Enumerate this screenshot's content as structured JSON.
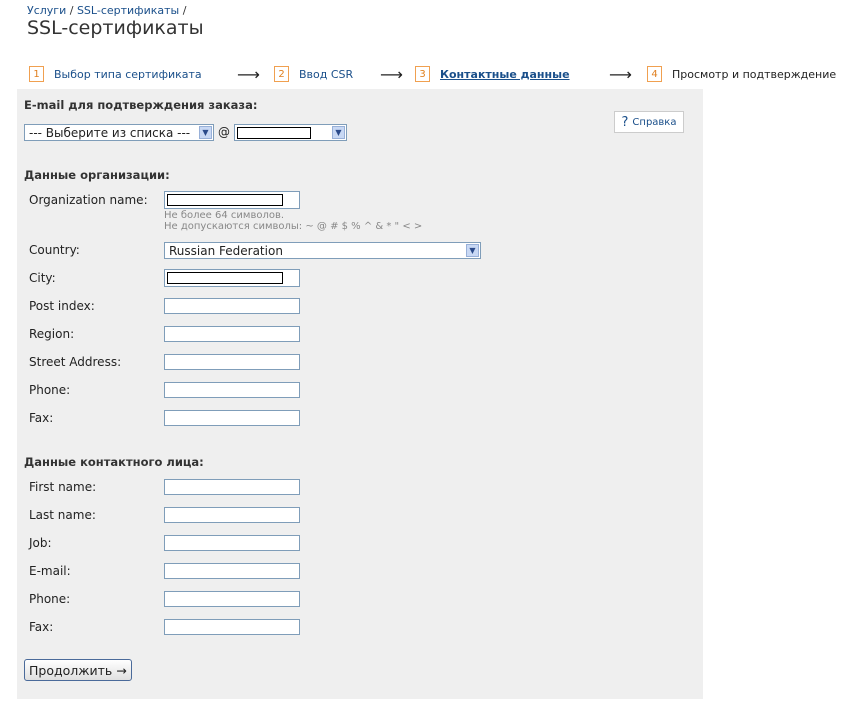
{
  "breadcrumb": {
    "items": [
      "Услуги",
      "SSL-сертификаты"
    ],
    "sep": "/"
  },
  "page_title": "SSL-сертификаты",
  "steps": [
    {
      "num": "1",
      "label": "Выбор типа сертификата"
    },
    {
      "num": "2",
      "label": "Ввод CSR"
    },
    {
      "num": "3",
      "label": "Контактные данные"
    },
    {
      "num": "4",
      "label": "Просмотр и подтверждение"
    }
  ],
  "arrow": "⟶",
  "email_section": {
    "title": "E-mail для подтверждения заказа:",
    "select_value": "--- Выберите из списка ---",
    "at": "@",
    "help_label": "Справка",
    "help_icon": "?"
  },
  "org_section": {
    "title": "Данные организации:",
    "fields": [
      {
        "label": "Organization name:"
      },
      {
        "label": "Country:"
      },
      {
        "label": "City:"
      },
      {
        "label": "Post index:"
      },
      {
        "label": "Region:"
      },
      {
        "label": "Street Address:"
      },
      {
        "label": "Phone:"
      },
      {
        "label": "Fax:"
      }
    ],
    "hint_1": "Не более 64 символов.",
    "hint_2": "Не допускаются символы: ~ @ # $ % ^ & * \" < >",
    "country_value": "Russian Federation"
  },
  "contact_section": {
    "title": "Данные контактного лица:",
    "fields": [
      {
        "label": "First name:"
      },
      {
        "label": "Last name:"
      },
      {
        "label": "Job:"
      },
      {
        "label": "E-mail:"
      },
      {
        "label": "Phone:"
      },
      {
        "label": "Fax:"
      }
    ]
  },
  "continue_button": "Продолжить →"
}
